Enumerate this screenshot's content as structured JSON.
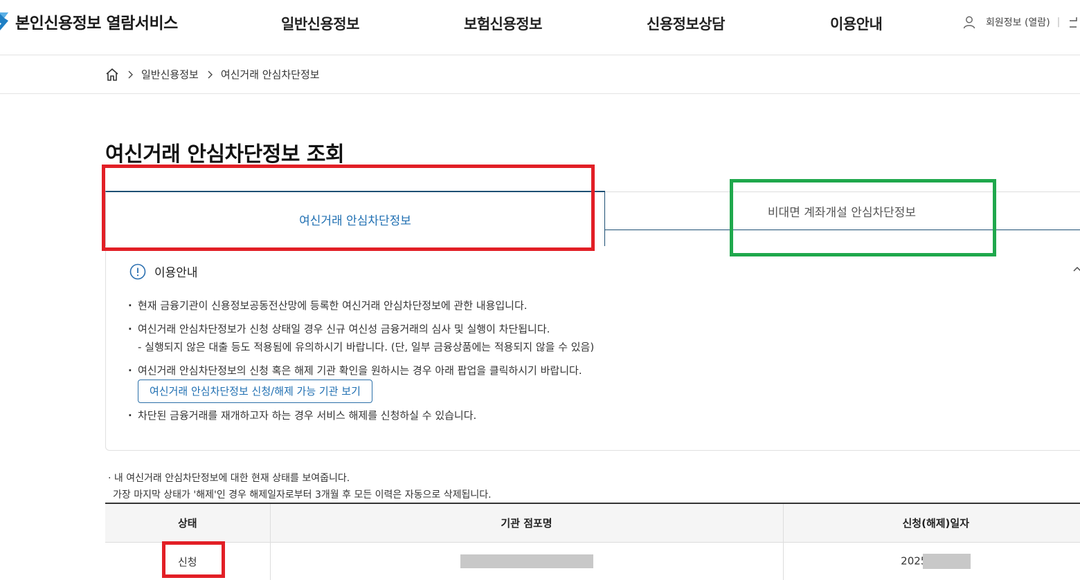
{
  "header": {
    "logo_text": "본인신용정보 열람서비스",
    "nav": [
      "일반신용정보",
      "보험신용정보",
      "신용정보상담",
      "이용안내"
    ],
    "member_info": "회원정보 (열람)",
    "divider": "|"
  },
  "breadcrumb": {
    "items": [
      "일반신용정보",
      "여신거래 안심차단정보"
    ]
  },
  "page_title": "여신거래 안심차단정보 조회",
  "tabs": {
    "active": "여신거래 안심차단정보",
    "inactive": "비대면 계좌개설 안심차단정보"
  },
  "info": {
    "title": "이용안내",
    "items": [
      "현재 금융기관이 신용정보공동전산망에 등록한 여신거래 안심차단정보에 관한 내용입니다.",
      "여신거래 안심차단정보가 신청 상태일 경우 신규 여신성 금융거래의 심사 및 실행이 차단됩니다.",
      "- 실행되지 않은 대출 등도 적용됨에 유의하시기 바랍니다. (단, 일부 금융상품에는 적용되지 않을 수 있음)",
      "여신거래 안심차단정보의 신청 혹은 해제 기관 확인을 원하시는 경우 아래 팝업을 클릭하시기 바랍니다.",
      "차단된 금융거래를 재개하고자 하는 경우 서비스 해제를 신청하실 수 있습니다."
    ],
    "button_label": "여신거래 안심차단정보 신청/해제 가능 기관 보기"
  },
  "notice": {
    "line1": "· 내 여신거래 안심차단정보에 대한 현재 상태를 보여줍니다.",
    "line2": "가장 마지막 상태가 '해제'인 경우 해제일자로부터 3개월 후 모든 이력은 자동으로 삭제됩니다."
  },
  "table": {
    "headers": [
      "상태",
      "기관 점포명",
      "신청(해제)일자"
    ],
    "rows": [
      {
        "status": "신청",
        "date_visible": "2025"
      }
    ]
  },
  "colors": {
    "highlight_red": "#e21f26",
    "highlight_green": "#1fa84c",
    "tab_active_text": "#1f6fb2",
    "brand_navy": "#1d4f73"
  }
}
